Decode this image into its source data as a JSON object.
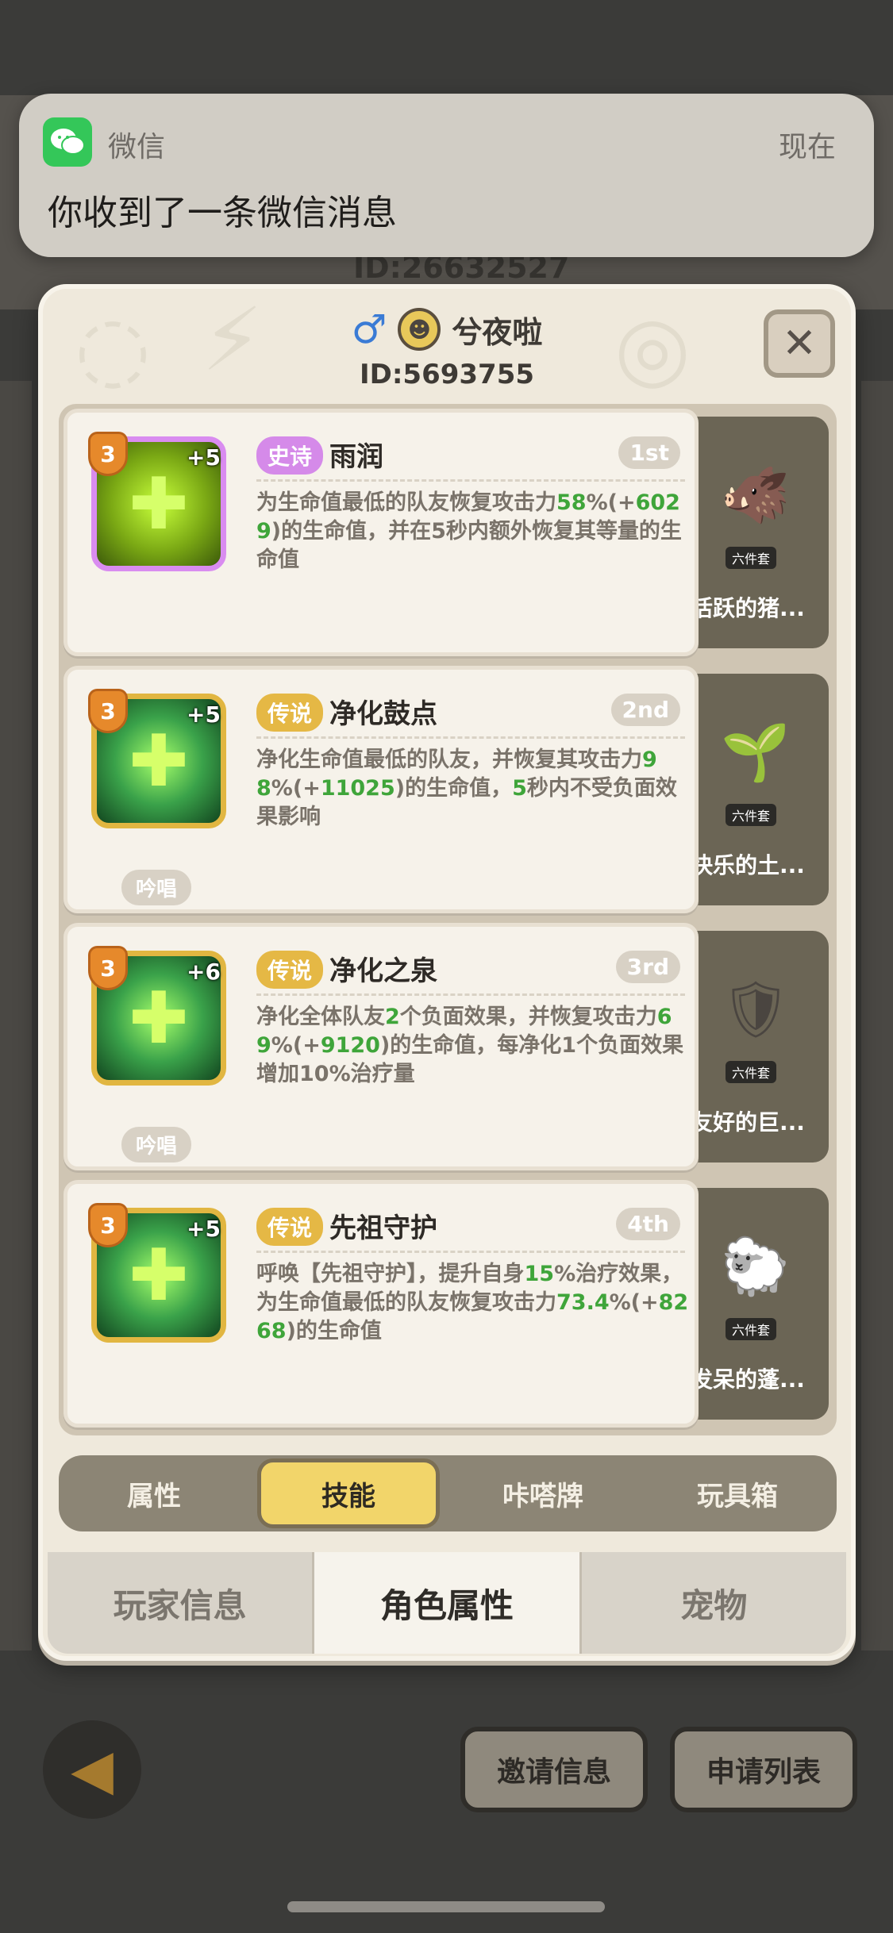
{
  "notification": {
    "app_name": "微信",
    "time": "现在",
    "message": "你收到了一条微信消息"
  },
  "background": {
    "player_id": "ID:26632527"
  },
  "profile": {
    "gender_symbol": "♂",
    "name": "兮夜啦",
    "id": "ID:5693755"
  },
  "skills": [
    {
      "rarity": "史诗",
      "name": "雨润",
      "rank": "1st",
      "level": "3",
      "plus": "+5",
      "chant": "",
      "desc_parts": [
        "为生命值最低的队友恢复攻击力",
        "58",
        "%(+",
        "6029",
        ")的生命值，并在5秒内额外恢复其等量的生命值"
      ],
      "pet_name": "活跃的猪...",
      "pet_set": "六件套"
    },
    {
      "rarity": "传说",
      "name": "净化鼓点",
      "rank": "2nd",
      "level": "3",
      "plus": "+5",
      "chant": "吟唱",
      "desc_parts": [
        "净化生命值最低的队友，并恢复其攻击力",
        "98",
        "%(+",
        "11025",
        ")的生命值，",
        "5",
        "秒内不受负面效果影响"
      ],
      "pet_name": "快乐的土...",
      "pet_set": "六件套"
    },
    {
      "rarity": "传说",
      "name": "净化之泉",
      "rank": "3rd",
      "level": "3",
      "plus": "+6",
      "chant": "吟唱",
      "desc_parts": [
        "净化全体队友",
        "2",
        "个负面效果，并恢复攻击力",
        "69",
        "%(+",
        "9120",
        ")的生命值，每净化1个负面效果增加10%治疗量"
      ],
      "pet_name": "友好的巨...",
      "pet_set": "六件套"
    },
    {
      "rarity": "传说",
      "name": "先祖守护",
      "rank": "4th",
      "level": "3",
      "plus": "+5",
      "chant": "",
      "desc_parts": [
        "呼唤【先祖守护】，提升自身",
        "15",
        "%治疗效果，为生命值最低的队友恢复攻击力",
        "73.4",
        "%(+",
        "8268",
        ")的生命值"
      ],
      "pet_name": "发呆的蓬...",
      "pet_set": "六件套"
    }
  ],
  "inner_tabs": [
    "属性",
    "技能",
    "咔嗒牌",
    "玩具箱"
  ],
  "bottom_tabs": [
    "玩家信息",
    "角色属性",
    "宠物"
  ],
  "footer": {
    "invite_label": "邀请信息",
    "apply_label": "申请列表"
  },
  "colors": {
    "epic": "#d58ae9",
    "legend": "#e5b845",
    "highlight_green": "#3fa53a",
    "active_tab": "#f2d56a"
  }
}
